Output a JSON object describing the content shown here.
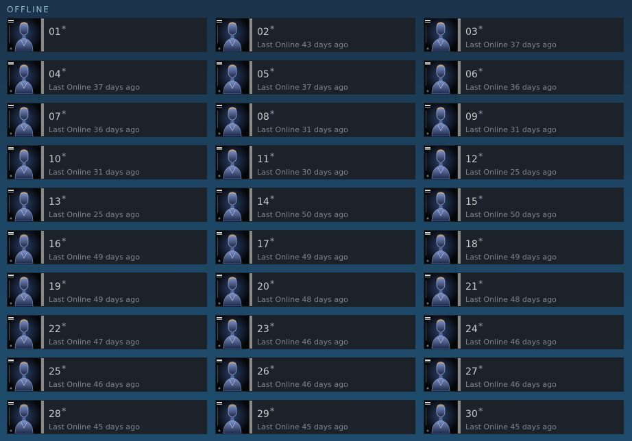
{
  "section": {
    "title": "OFFLINE"
  },
  "colors": {
    "offline_bar": "#898989",
    "tile_bg": "#1c222a"
  },
  "avatar_icon": "robot-figure-avatar",
  "friends": [
    {
      "name": "01",
      "star": "*",
      "status": ""
    },
    {
      "name": "02",
      "star": "*",
      "status": "Last Online 43 days ago"
    },
    {
      "name": "03",
      "star": "*",
      "status": "Last Online 37 days ago"
    },
    {
      "name": "04",
      "star": "*",
      "status": "Last Online 37 days ago"
    },
    {
      "name": "05",
      "star": "*",
      "status": "Last Online 37 days ago"
    },
    {
      "name": "06",
      "star": "*",
      "status": "Last Online 36 days ago"
    },
    {
      "name": "07",
      "star": "*",
      "status": "Last Online 36 days ago"
    },
    {
      "name": "08",
      "star": "*",
      "status": "Last Online 31 days ago"
    },
    {
      "name": "09",
      "star": "*",
      "status": "Last Online 31 days ago"
    },
    {
      "name": "10",
      "star": "*",
      "status": "Last Online 31 days ago"
    },
    {
      "name": "11",
      "star": "*",
      "status": "Last Online 30 days ago"
    },
    {
      "name": "12",
      "star": "*",
      "status": "Last Online 25 days ago"
    },
    {
      "name": "13",
      "star": "*",
      "status": "Last Online 25 days ago"
    },
    {
      "name": "14",
      "star": "*",
      "status": "Last Online 50 days ago"
    },
    {
      "name": "15",
      "star": "*",
      "status": "Last Online 50 days ago"
    },
    {
      "name": "16",
      "star": "*",
      "status": "Last Online 49 days ago"
    },
    {
      "name": "17",
      "star": "*",
      "status": "Last Online 49 days ago"
    },
    {
      "name": "18",
      "star": "*",
      "status": "Last Online 49 days ago"
    },
    {
      "name": "19",
      "star": "*",
      "status": "Last Online 49 days ago"
    },
    {
      "name": "20",
      "star": "*",
      "status": "Last Online 48 days ago"
    },
    {
      "name": "21",
      "star": "*",
      "status": "Last Online 48 days ago"
    },
    {
      "name": "22",
      "star": "*",
      "status": "Last Online 47 days ago"
    },
    {
      "name": "23",
      "star": "*",
      "status": "Last Online 46 days ago"
    },
    {
      "name": "24",
      "star": "*",
      "status": "Last Online 46 days ago"
    },
    {
      "name": "25",
      "star": "*",
      "status": "Last Online 46 days ago"
    },
    {
      "name": "26",
      "star": "*",
      "status": "Last Online 46 days ago"
    },
    {
      "name": "27",
      "star": "*",
      "status": "Last Online 46 days ago"
    },
    {
      "name": "28",
      "star": "*",
      "status": "Last Online 45 days ago"
    },
    {
      "name": "29",
      "star": "*",
      "status": "Last Online 45 days ago"
    },
    {
      "name": "30",
      "star": "*",
      "status": "Last Online 45 days ago"
    }
  ]
}
